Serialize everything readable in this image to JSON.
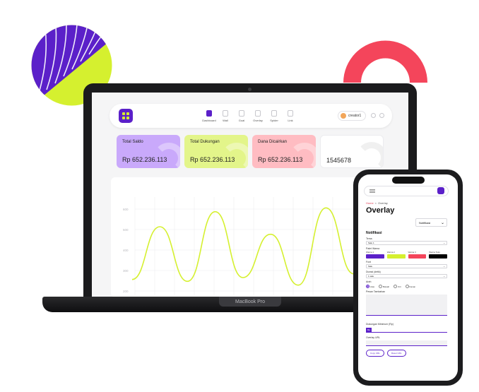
{
  "colors": {
    "accent": "#5b20c9",
    "lime": "#d5f02f",
    "coral": "#f4455b",
    "card_saldo": "#c9a9fb",
    "card_dukungan": "#e3f58a",
    "card_dicairkan": "#ffbcc2",
    "card_plain": "#ffffff",
    "swatch_1": "#5b20c9",
    "swatch_2": "#d5f02f",
    "swatch_3": "#f4455b",
    "swatch_4": "#000000"
  },
  "laptop": {
    "label": "MacBook Pro",
    "nav": [
      {
        "label": "Dashboard",
        "icon": "bar-chart-icon",
        "active": true
      },
      {
        "label": "Wall",
        "icon": "document-icon",
        "active": false
      },
      {
        "label": "Goal",
        "icon": "target-icon",
        "active": false
      },
      {
        "label": "Overlay",
        "icon": "tag-icon",
        "active": false
      },
      {
        "label": "Spider",
        "icon": "home-icon",
        "active": false
      },
      {
        "label": "Link",
        "icon": "pen-icon",
        "active": false
      }
    ],
    "user": "creator1",
    "cards": [
      {
        "title": "Total Saldo",
        "value": "Rp 652.236.113"
      },
      {
        "title": "Total Dukungan",
        "value": "Rp 652.236.113"
      },
      {
        "title": "Dana Dicairkan",
        "value": "Rp 652.236.113"
      },
      {
        "title": "",
        "value": "1545678"
      }
    ],
    "chart_data": {
      "type": "line",
      "title": "",
      "ylabel": "",
      "ytick_labels": [
        "600",
        "500",
        "400",
        "300",
        "200"
      ],
      "series": [
        {
          "values": [
            200,
            480,
            190,
            560,
            210,
            440,
            170,
            580,
            230,
            510
          ]
        }
      ]
    }
  },
  "phone": {
    "breadcrumb_home": "Home",
    "breadcrumb_sep": "<",
    "breadcrumb_current": "Overlay",
    "title": "Overlay",
    "type_select": "Notifikasi",
    "form": {
      "heading": "Notifikasi",
      "tema_label": "Tema",
      "tema_value": "Satu 1",
      "palet_label": "Palet Warna",
      "swatches": [
        "Warna 1",
        "Warna 2",
        "Warna 3",
        "Warna Teks"
      ],
      "font_label": "Font",
      "font_value": "Satu",
      "durasi_label": "Durasi (detik)",
      "durasi_value": "1 satu",
      "arah_label": "Arah",
      "arah_options": [
        "Atas",
        "Bawah",
        "Kiri",
        "Kanan"
      ],
      "pesan_label": "Pesan Tambahan",
      "minimum_label": "Dukungan Minimum (Rp)",
      "minimum_tag": "Rp",
      "url_label": "Overlay URL",
      "copy_button": "Copy URL",
      "reset_button": "Reset URL"
    }
  }
}
